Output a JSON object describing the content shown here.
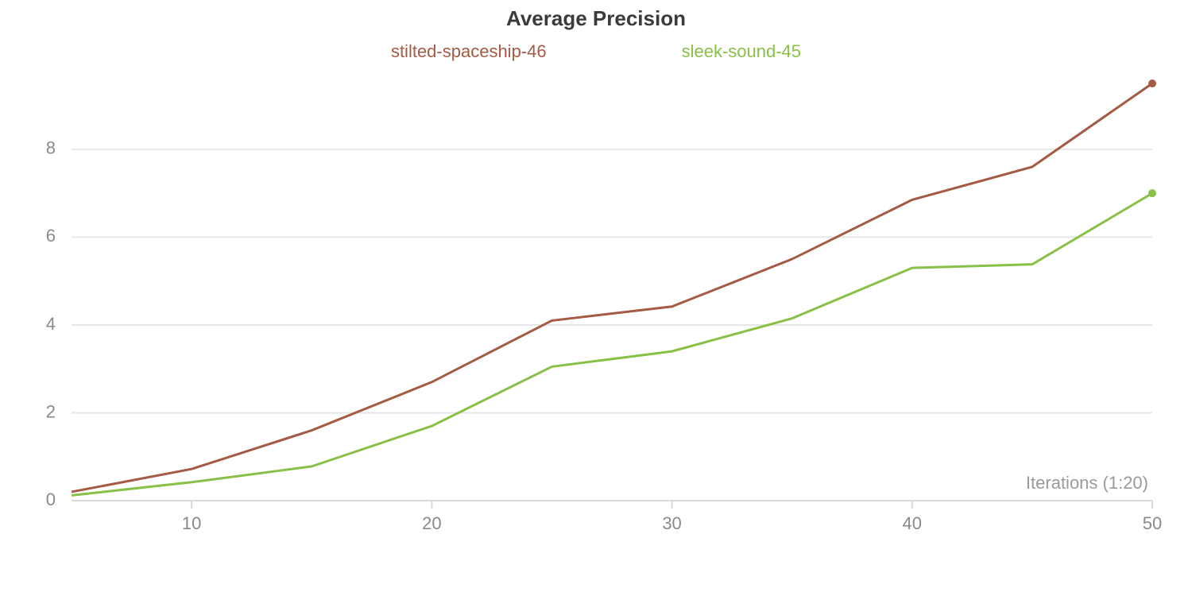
{
  "chart_data": {
    "type": "line",
    "title": "Average Precision",
    "xlabel": "Iterations (1:20)",
    "ylabel": "",
    "x_ticks": [
      10,
      20,
      30,
      40,
      50
    ],
    "y_ticks": [
      0,
      2,
      4,
      6,
      8
    ],
    "ylim": [
      0,
      9.5
    ],
    "xlim": [
      5,
      50
    ],
    "x": [
      5,
      10,
      15,
      20,
      25,
      30,
      35,
      40,
      45,
      50
    ],
    "series": [
      {
        "name": "stilted-spaceship-46",
        "color": "#a55a44",
        "values": [
          0.2,
          0.72,
          1.6,
          2.7,
          4.1,
          4.42,
          5.5,
          6.85,
          7.6,
          9.5
        ]
      },
      {
        "name": "sleek-sound-45",
        "color": "#88c048",
        "values": [
          0.12,
          0.42,
          0.78,
          1.7,
          3.05,
          3.4,
          4.15,
          5.3,
          5.38,
          7.0
        ]
      }
    ]
  }
}
